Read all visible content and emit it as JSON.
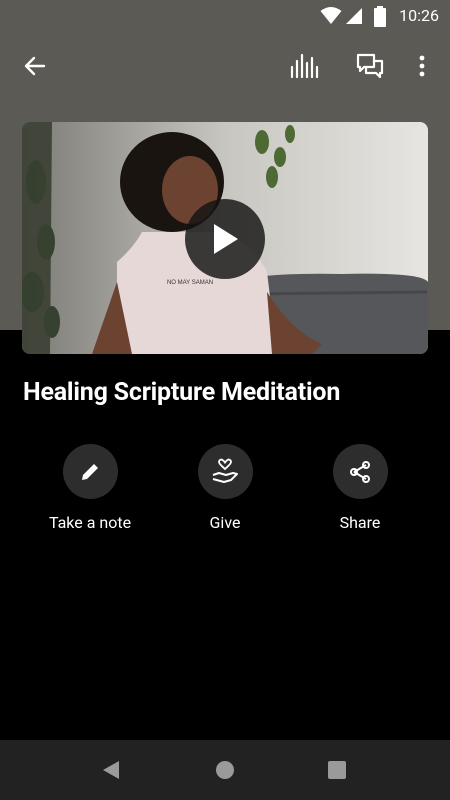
{
  "status_bar": {
    "time": "10:26"
  },
  "app_bar": {
    "back_icon": "arrow-back-icon",
    "audio_icon": "audio-waveform-icon",
    "chat_icon": "chat-bubbles-icon",
    "more_icon": "more-vert-icon"
  },
  "media": {
    "play_icon": "play-icon",
    "shirt_text": "NO MAY SAMAN"
  },
  "title": "Healing Scripture Meditation",
  "actions": [
    {
      "label": "Take a note",
      "icon": "pencil-icon"
    },
    {
      "label": "Give",
      "icon": "hand-heart-icon"
    },
    {
      "label": "Share",
      "icon": "share-icon"
    }
  ],
  "colors": {
    "header_bg": "#5b5a55",
    "body_bg": "#000000",
    "action_circle": "#2d2d2d",
    "nav_bg": "#222222"
  }
}
